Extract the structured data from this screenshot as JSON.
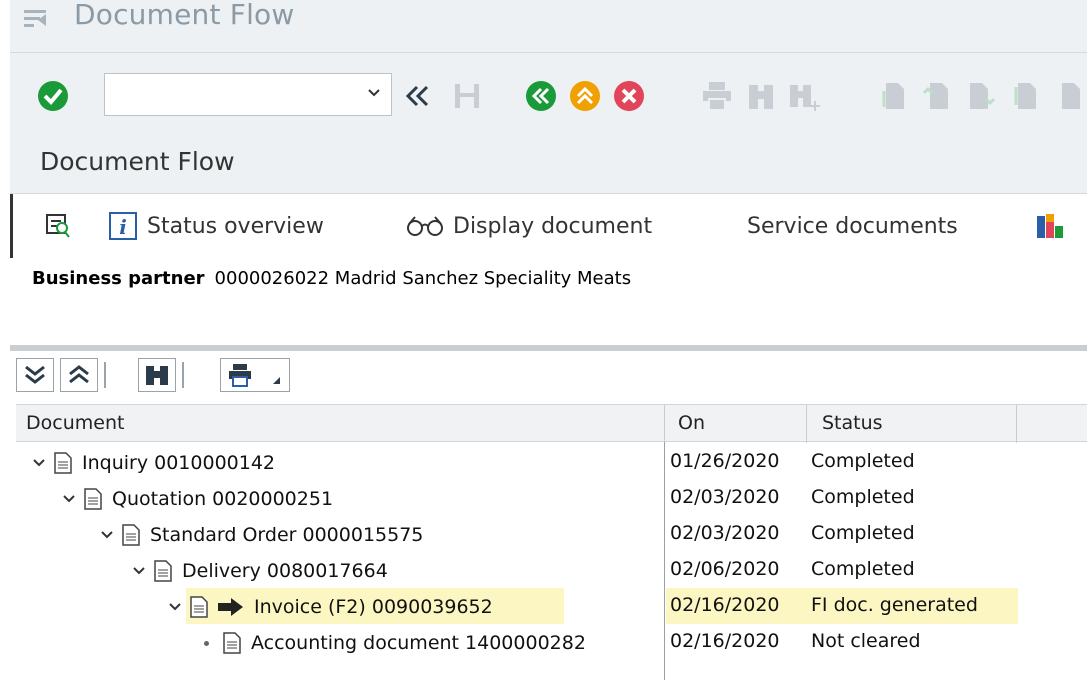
{
  "window": {
    "title": "Document Flow"
  },
  "toolbar": {
    "command_value": "",
    "command_placeholder": ""
  },
  "app": {
    "subtitle": "Document Flow"
  },
  "appbar": {
    "status_overview": "Status overview",
    "display_document": "Display document",
    "service_documents": "Service documents"
  },
  "business_partner": {
    "label": "Business partner",
    "value": "0000026022 Madrid Sanchez Speciality Meats"
  },
  "tree": {
    "columns": [
      "Document",
      "On",
      "Status"
    ],
    "rows": [
      {
        "doc": "Inquiry 0010000142",
        "on": "01/26/2020",
        "status": "Completed"
      },
      {
        "doc": "Quotation 0020000251",
        "on": "02/03/2020",
        "status": "Completed"
      },
      {
        "doc": "Standard Order 0000015575",
        "on": "02/03/2020",
        "status": "Completed"
      },
      {
        "doc": "Delivery 0080017664",
        "on": "02/06/2020",
        "status": "Completed"
      },
      {
        "doc": "Invoice (F2) 0090039652",
        "on": "02/16/2020",
        "status": "FI doc. generated"
      },
      {
        "doc": "Accounting document 1400000282",
        "on": "02/16/2020",
        "status": "Not cleared"
      }
    ]
  },
  "colors": {
    "accent_green": "#1b9a3a",
    "accent_orange": "#f0a000",
    "accent_red": "#e0455a",
    "highlight": "#fcf6c2"
  }
}
